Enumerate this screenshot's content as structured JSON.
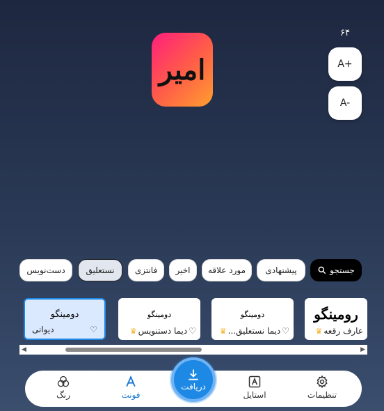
{
  "preview": {
    "text": "امیر",
    "size": "۶۴"
  },
  "size_controls": {
    "increase": "A+",
    "decrease": "A-"
  },
  "categories": [
    {
      "label": "جستجو",
      "type": "search"
    },
    {
      "label": "پیشنهادی"
    },
    {
      "label": "مورد علاقه"
    },
    {
      "label": "اخیر"
    },
    {
      "label": "فانتزی"
    },
    {
      "label": "نستعلیق",
      "active": true
    },
    {
      "label": "دست‌نویس"
    }
  ],
  "fonts": [
    {
      "preview": "رومینگو",
      "name": "عارف رقعه",
      "premium": true,
      "favorite": false
    },
    {
      "preview": "دومینگو",
      "name": "دیما نستعلیق...",
      "premium": true,
      "favorite": true
    },
    {
      "preview": "دومینگو",
      "name": "دیما دستنویس",
      "premium": true,
      "favorite": true
    },
    {
      "preview": "دومینگو",
      "name": "دیوانی",
      "premium": false,
      "favorite": true,
      "selected": true
    }
  ],
  "nav": {
    "settings": "تنظیمات",
    "style": "استایل",
    "download": "دریافت",
    "font": "فونت",
    "color": "رنگ"
  },
  "colors": {
    "accent": "#1e88e5",
    "premium": "#f2b01e"
  }
}
